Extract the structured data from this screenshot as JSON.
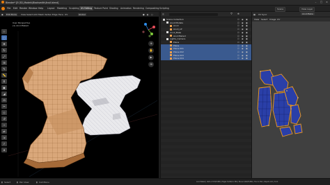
{
  "window": {
    "title": "Blender* [E:\\3D_Models\\Blacksmith\\Anvil.blend]"
  },
  "menu": {
    "items": [
      "File",
      "Edit",
      "Render",
      "Window",
      "Help"
    ],
    "workspaces": [
      "Layout",
      "Modeling",
      "Sculpting",
      "UV Editing",
      "Texture Paint",
      "Shading",
      "Animation",
      "Rendering",
      "Compositing",
      "Scripting"
    ],
    "active_workspace": "UV Editing",
    "scene": "Scene",
    "view_layer": "View Layer"
  },
  "viewport": {
    "mode": "Edit Mode",
    "header_items": [
      "View",
      "Select",
      "Add",
      "Mesh",
      "Vertex",
      "Edge",
      "Face",
      "UV"
    ],
    "info_line1": "User Perspective",
    "info_line2": "(1) Anvil Baked",
    "shading": "Global",
    "tool_icons": [
      "cursor-icon",
      "select-box-icon",
      "move-icon",
      "rotate-icon",
      "scale-icon",
      "transform-icon",
      "annotate-icon",
      "measure-icon",
      "extrude-icon",
      "inset-icon",
      "bevel-icon",
      "loop-cut-icon",
      "knife-icon",
      "poly-build-icon",
      "spin-icon",
      "smooth-icon",
      "slide-icon",
      "shrink-icon",
      "shear-icon",
      "rip-icon"
    ]
  },
  "outliner": {
    "search_placeholder": "",
    "rows": [
      {
        "label": "Scene Collection",
        "indent": 0,
        "icon": "#d0d0d0",
        "selected": false
      },
      {
        "label": "Anvil Models",
        "indent": 1,
        "icon": "#e0e0e0",
        "selected": false
      },
      {
        "label": "Anvil",
        "indent": 2,
        "icon": "#f2a04a",
        "selected": false
      },
      {
        "label": "Anvil_LP",
        "indent": 2,
        "icon": "#f2a04a",
        "selected": false
      },
      {
        "label": "Anvil_Bake",
        "indent": 1,
        "icon": "#e0e0e0",
        "selected": false
      },
      {
        "label": "Anvil Baked",
        "indent": 2,
        "icon": "#f2a04a",
        "selected": false
      },
      {
        "label": "Lights_Camera",
        "indent": 1,
        "icon": "#e0e0e0",
        "selected": false
      },
      {
        "label": "Plane",
        "indent": 2,
        "icon": "#f2a04a",
        "selected": false
      },
      {
        "label": "Plane",
        "indent": 2,
        "icon": "#f2a04a",
        "selected": true
      },
      {
        "label": "Plane.001",
        "indent": 2,
        "icon": "#f2a04a",
        "selected": true
      },
      {
        "label": "Plane.002",
        "indent": 2,
        "icon": "#f2a04a",
        "selected": true
      },
      {
        "label": "Plane.003",
        "indent": 2,
        "icon": "#f2a04a",
        "selected": true
      },
      {
        "label": "Plane.004",
        "indent": 2,
        "icon": "#f2a04a",
        "selected": true
      }
    ]
  },
  "uv_editor": {
    "header_items": [
      "View",
      "Select",
      "Image",
      "UV"
    ],
    "image_name": "Anvil Bake",
    "sync": "UV Sync"
  },
  "status": {
    "left_items": [
      "Select",
      "Pan View",
      "Call Menu"
    ],
    "right_text": "Anvil Baked | Verts 2,574/5,880 | Edges 5,264/11,760 | Faces 2,692/5,880 | Tris 11,760 | Objects 1/8 | 3.6.0"
  },
  "colors": {
    "accent": "#4772b3",
    "selection": "#3a5a8f",
    "object_orange": "#f2a04a",
    "uv_blue": "#2a3fa8",
    "uv_orange": "#f29b1d"
  }
}
